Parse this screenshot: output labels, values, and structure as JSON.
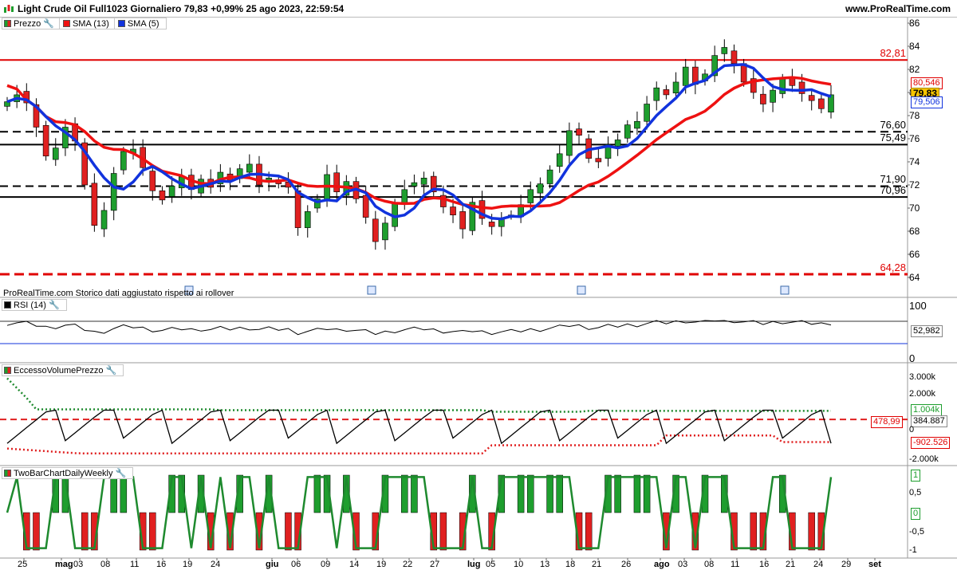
{
  "header": {
    "title": "Light Crude Oil Full1023 Giornaliero 79,83 +0,99% 25 ago 2023, 22:59:54",
    "site": "www.ProRealTime.com"
  },
  "price_panel": {
    "legend": {
      "price": "Prezzo",
      "sma13": "SMA (13)",
      "sma5": "SMA (5)"
    },
    "y_ticks": [
      "86",
      "84",
      "82",
      "80",
      "78",
      "76",
      "74",
      "72",
      "70",
      "68",
      "66",
      "64"
    ],
    "levels": [
      {
        "label": "82,81",
        "color": "#e00000"
      },
      {
        "label": "76,60",
        "color": "#000000"
      },
      {
        "label": "75,49",
        "color": "#000000"
      },
      {
        "label": "71,90",
        "color": "#000000"
      },
      {
        "label": "70,96",
        "color": "#000000"
      },
      {
        "label": "64,28",
        "color": "#e00000"
      }
    ],
    "tags": {
      "sma13": "80,546",
      "last": "79,83",
      "sma5": "79,506"
    },
    "footnote": "ProRealTime.com Storico dati aggiustato rispetto ai rollover"
  },
  "rsi_panel": {
    "legend": "RSI (14)",
    "y_ticks": [
      "100",
      "0"
    ],
    "value": "52,982"
  },
  "volume_panel": {
    "legend": "EccessoVolumePrezzo",
    "y_ticks": [
      "3.000k",
      "2.000k",
      "1.000k",
      "0",
      "-1.000k",
      "-2.000k"
    ],
    "tags": {
      "upper": "1.004k",
      "mid": "478,99",
      "value": "384.887",
      "zero": "0",
      "lower": "-902.526"
    }
  },
  "twobar_panel": {
    "legend": "TwoBarChartDailyWeekly",
    "y_ticks": [
      "1",
      "0,5",
      "0",
      "-0,5",
      "-1"
    ]
  },
  "x_axis": [
    {
      "label": "25",
      "bold": false
    },
    {
      "label": "mag",
      "bold": true
    },
    {
      "label": "03",
      "bold": false
    },
    {
      "label": "08",
      "bold": false
    },
    {
      "label": "11",
      "bold": false
    },
    {
      "label": "16",
      "bold": false
    },
    {
      "label": "19",
      "bold": false
    },
    {
      "label": "24",
      "bold": false
    },
    {
      "label": "giu",
      "bold": true
    },
    {
      "label": "06",
      "bold": false
    },
    {
      "label": "09",
      "bold": false
    },
    {
      "label": "14",
      "bold": false
    },
    {
      "label": "19",
      "bold": false
    },
    {
      "label": "22",
      "bold": false
    },
    {
      "label": "27",
      "bold": false
    },
    {
      "label": "lug",
      "bold": true
    },
    {
      "label": "05",
      "bold": false
    },
    {
      "label": "10",
      "bold": false
    },
    {
      "label": "13",
      "bold": false
    },
    {
      "label": "18",
      "bold": false
    },
    {
      "label": "21",
      "bold": false
    },
    {
      "label": "26",
      "bold": false
    },
    {
      "label": "ago",
      "bold": true
    },
    {
      "label": "03",
      "bold": false
    },
    {
      "label": "08",
      "bold": false
    },
    {
      "label": "11",
      "bold": false
    },
    {
      "label": "16",
      "bold": false
    },
    {
      "label": "21",
      "bold": false
    },
    {
      "label": "24",
      "bold": false
    },
    {
      "label": "29",
      "bold": false
    },
    {
      "label": "set",
      "bold": true
    }
  ],
  "colors": {
    "up": "#1e9e2e",
    "down": "#e02020",
    "sma13": "#ee1111",
    "sma5": "#1133dd"
  },
  "chart_data": {
    "type": "candlestick",
    "series_close": [
      79.2,
      79.8,
      79.1,
      77.0,
      74.5,
      75.2,
      77.0,
      75.8,
      72.0,
      68.5,
      69.8,
      73.0,
      74.9,
      75.1,
      73.5,
      71.5,
      70.7,
      71.9,
      72.7,
      71.6,
      72.5,
      71.8,
      73.1,
      72.4,
      73.4,
      73.8,
      72.0,
      72.6,
      72.1,
      71.8,
      68.3,
      69.7,
      70.8,
      72.9,
      71.4,
      72.3,
      70.8,
      69.2,
      67.1,
      68.7,
      70.4,
      71.6,
      72.2,
      72.6,
      71.4,
      70.1,
      69.4,
      68.2,
      70.5,
      69.1,
      68.4,
      69.1,
      69.4,
      70.3,
      71.6,
      72.1,
      73.3,
      74.7,
      76.7,
      76.3,
      74.3,
      74.0,
      75.5,
      75.9,
      77.2,
      77.5,
      79.0,
      80.4,
      79.8,
      80.9,
      82.2,
      80.7,
      81.6,
      83.2,
      83.9,
      82.5,
      80.9,
      80.0,
      79.0,
      80.2,
      81.2,
      80.6,
      79.9,
      79.3,
      78.6,
      79.8
    ],
    "sma13_last": 80.546,
    "sma5_last": 79.506,
    "last": 79.83
  }
}
